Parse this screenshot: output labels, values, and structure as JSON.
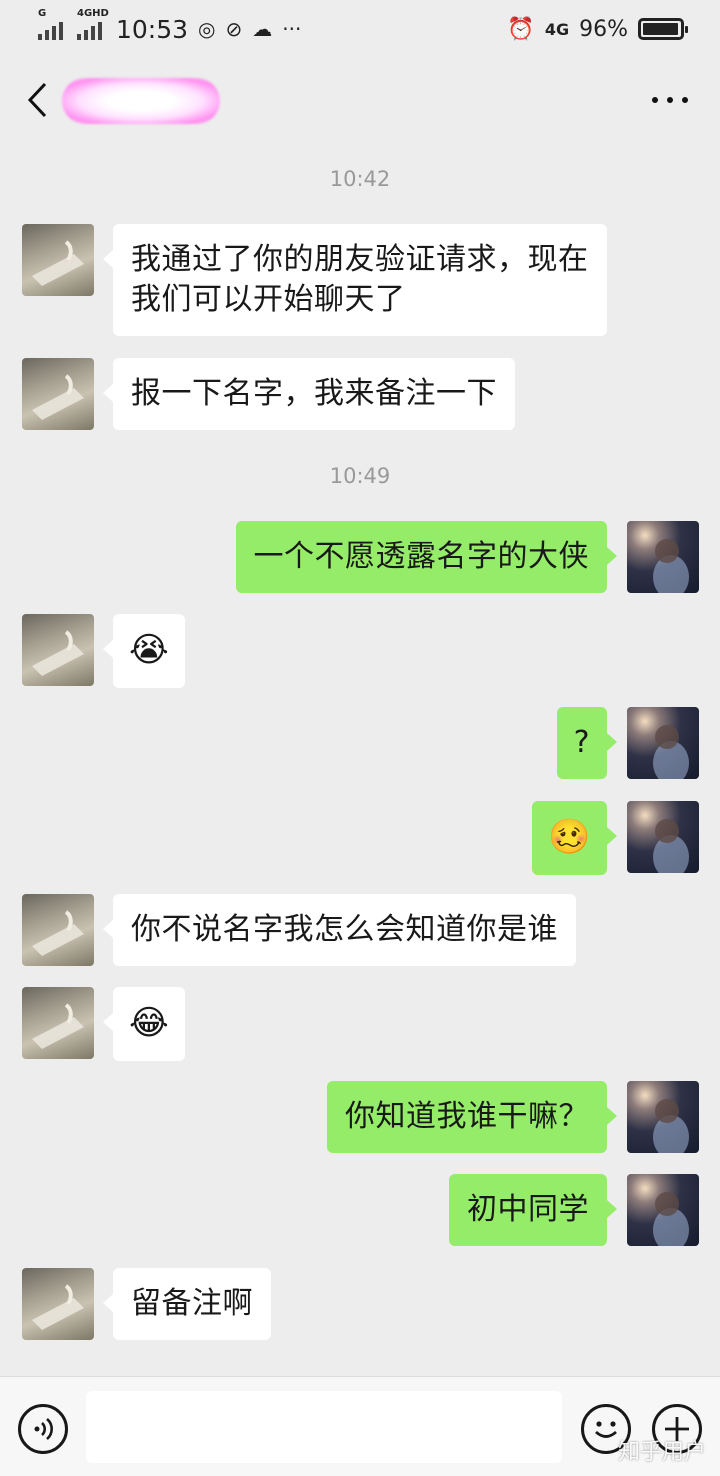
{
  "status_bar": {
    "network_left": "G",
    "network_right": "4GHD",
    "time": "10:53",
    "network_type": "4G",
    "battery": "96%",
    "battery_level": 0.96
  },
  "header": {
    "more_icon": "more-dots-icon",
    "back_icon": "chevron-left-icon"
  },
  "timestamps": [
    "10:42",
    "10:49"
  ],
  "messages": [
    {
      "from": "friend",
      "text": "我通过了你的朋友验证请求，现在我们可以开始聊天了"
    },
    {
      "from": "friend",
      "text": "报一下名字，我来备注一下"
    },
    {
      "from": "me",
      "text": "一个不愿透露名字的大侠"
    },
    {
      "from": "friend",
      "text": "😭"
    },
    {
      "from": "me",
      "text": "?"
    },
    {
      "from": "me",
      "text": "🥴"
    },
    {
      "from": "friend",
      "text": "你不说名字我怎么会知道你是谁"
    },
    {
      "from": "friend",
      "text": "😂"
    },
    {
      "from": "me",
      "text": "你知道我谁干嘛？"
    },
    {
      "from": "me",
      "text": "初中同学"
    },
    {
      "from": "friend",
      "text": "留备注啊"
    }
  ],
  "input_bar": {
    "voice_icon": "voice-icon",
    "emoji_icon": "emoji-icon",
    "plus_icon": "plus-icon",
    "input_value": ""
  },
  "watermark": "知乎用户"
}
